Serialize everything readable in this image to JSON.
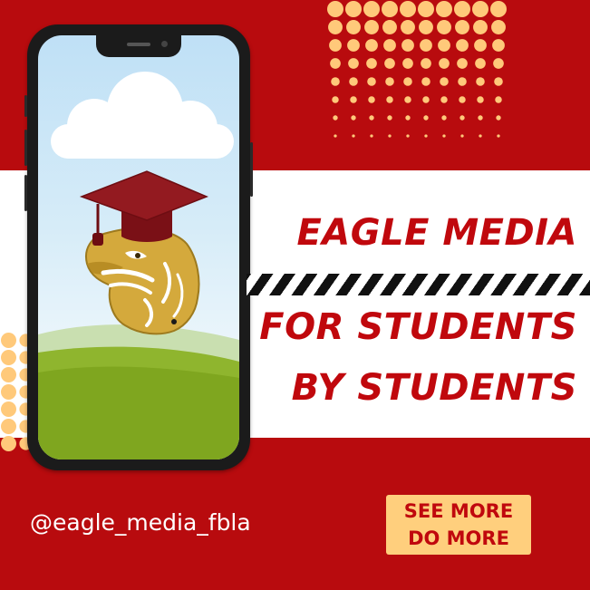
{
  "headline": {
    "line1": "EAGLE MEDIA",
    "line2": "FOR STUDENTS",
    "line3": "BY STUDENTS"
  },
  "social": {
    "handle": "@eagle_media_fbla"
  },
  "cta": {
    "line1": "SEE MORE",
    "line2": "DO MORE"
  },
  "icons": {
    "logo": "eagle-graduation-cap-mascot",
    "phone": "smartphone"
  },
  "colors": {
    "background": "#b80b0e",
    "band": "#ffffff",
    "headline_text": "#c0080d",
    "dots": "#ffc97a",
    "cta_fill": "#ffcf7d",
    "mascot_gold": "#d4a93c",
    "cap_maroon": "#8e1419"
  }
}
